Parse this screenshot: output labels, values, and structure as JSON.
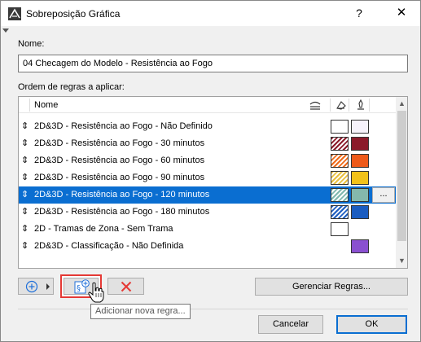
{
  "window": {
    "title": "Sobreposição Gráfica",
    "help_label": "?",
    "close_label": "✕"
  },
  "name_field": {
    "label": "Nome:",
    "value": "04 Checagem do Modelo - Resistência ao Fogo"
  },
  "rules": {
    "label": "Ordem de regras a aplicar:",
    "header": {
      "name_label": "Nome",
      "icons": [
        "surface-icon",
        "fill-icon",
        "pen-icon"
      ]
    },
    "items": [
      {
        "label": "2D&3D - Resistência ao Fogo - Não Definido",
        "swatch1": {
          "type": "solid",
          "color": "#ffffff"
        },
        "swatch2": {
          "type": "solid",
          "color": "#f7f3fb"
        },
        "selected": false
      },
      {
        "label": "2D&3D - Resistência ao Fogo -  30 minutos",
        "swatch1": {
          "type": "hatch",
          "color": "#8b1a2a"
        },
        "swatch2": {
          "type": "solid",
          "color": "#8b1a2a"
        },
        "selected": false
      },
      {
        "label": "2D&3D - Resistência ao Fogo -  60 minutos",
        "swatch1": {
          "type": "hatch",
          "color": "#ee6a1a"
        },
        "swatch2": {
          "type": "solid",
          "color": "#ee5a1a"
        },
        "selected": false
      },
      {
        "label": "2D&3D - Resistência ao Fogo -  90 minutos",
        "swatch1": {
          "type": "hatch",
          "color": "#e8c040"
        },
        "swatch2": {
          "type": "solid",
          "color": "#f2c21a"
        },
        "selected": false
      },
      {
        "label": "2D&3D - Resistência ao Fogo - 120 minutos",
        "swatch1": {
          "type": "hatch",
          "color": "#7fb8ae"
        },
        "swatch2": {
          "type": "solid",
          "color": "#84b8ac"
        },
        "selected": true,
        "more_label": "..."
      },
      {
        "label": "2D&3D - Resistência ao Fogo - 180 minutos",
        "swatch1": {
          "type": "hatch",
          "color": "#1e5ec0"
        },
        "swatch2": {
          "type": "solid",
          "color": "#1a5cc0"
        },
        "selected": false
      },
      {
        "label": "2D - Tramas de Zona - Sem Trama",
        "swatch1": {
          "type": "solid",
          "color": "#ffffff"
        },
        "swatch2": null,
        "selected": false
      },
      {
        "label": "2D&3D - Classificação - Não Definida",
        "swatch1": null,
        "swatch2": {
          "type": "solid",
          "color": "#8a50d0"
        },
        "selected": false
      }
    ]
  },
  "toolbar": {
    "manage_label": "Gerenciar Regras...",
    "tooltip": "Adicionar nova regra..."
  },
  "footer": {
    "cancel_label": "Cancelar",
    "ok_label": "OK"
  },
  "colors": {
    "selection": "#0a6ed1",
    "highlight_border": "#e53935",
    "delete_icon": "#e53935",
    "add_icon": "#1e6fd9"
  }
}
